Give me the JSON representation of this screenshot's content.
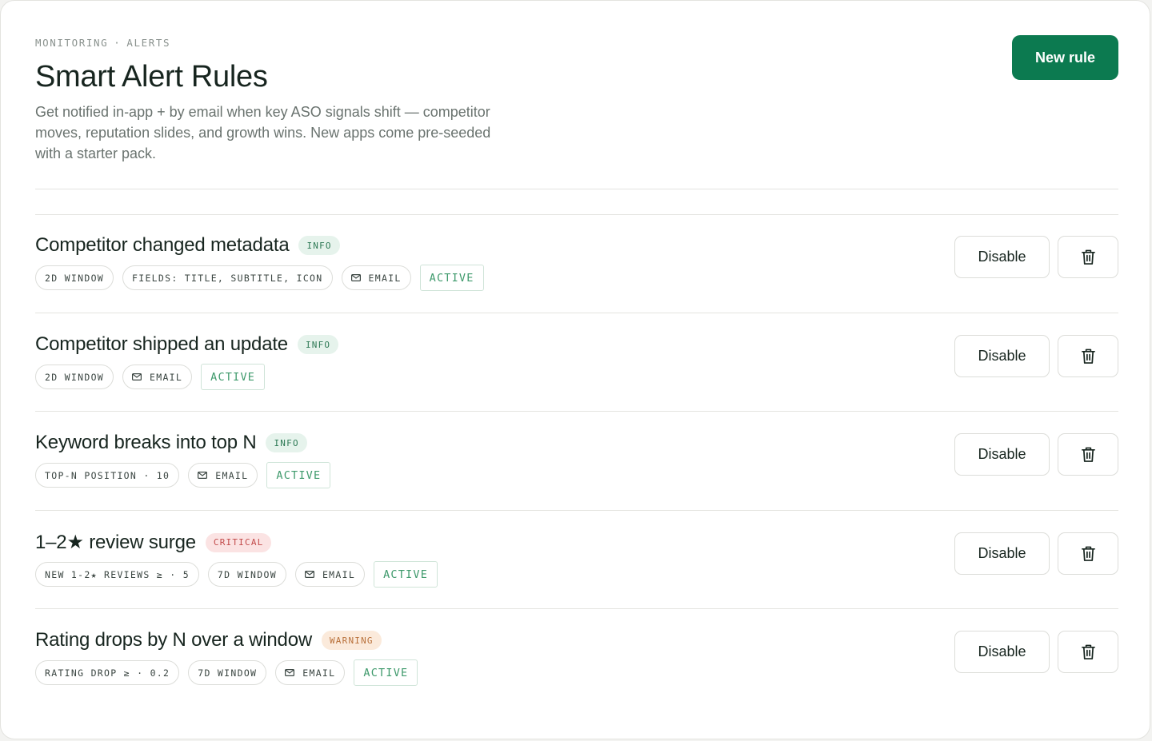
{
  "header": {
    "breadcrumb": [
      "MONITORING",
      "ALERTS"
    ],
    "breadcrumb_separator": "·",
    "title": "Smart Alert Rules",
    "subtitle": "Get notified in-app + by email when key ASO signals shift — competitor moves, reputation slides, and growth wins. New apps come pre-seeded with a starter pack.",
    "new_rule_label": "New rule"
  },
  "colors": {
    "accent": "#0c7a50",
    "info": "#2f7a56",
    "critical": "#c24a4a",
    "warning": "#b8703a",
    "active": "#3f9a6c"
  },
  "rules": [
    {
      "title": "Competitor changed metadata",
      "severity": "INFO",
      "severity_level": "info",
      "chips": [
        "2D WINDOW",
        "FIELDS: TITLE, SUBTITLE, ICON"
      ],
      "channel": "EMAIL",
      "channel_icon": "mail-icon",
      "status": "ACTIVE",
      "disable_label": "Disable",
      "delete_icon": "trash-icon"
    },
    {
      "title": "Competitor shipped an update",
      "severity": "INFO",
      "severity_level": "info",
      "chips": [
        "2D WINDOW"
      ],
      "channel": "EMAIL",
      "channel_icon": "mail-icon",
      "status": "ACTIVE",
      "disable_label": "Disable",
      "delete_icon": "trash-icon"
    },
    {
      "title": "Keyword breaks into top N",
      "severity": "INFO",
      "severity_level": "info",
      "chips": [
        "TOP-N POSITION · 10"
      ],
      "channel": "EMAIL",
      "channel_icon": "mail-icon",
      "status": "ACTIVE",
      "disable_label": "Disable",
      "delete_icon": "trash-icon"
    },
    {
      "title": "1–2★ review surge",
      "severity": "CRITICAL",
      "severity_level": "critical",
      "chips": [
        "NEW 1-2★ REVIEWS ≥ · 5",
        "7D WINDOW"
      ],
      "channel": "EMAIL",
      "channel_icon": "mail-icon",
      "status": "ACTIVE",
      "disable_label": "Disable",
      "delete_icon": "trash-icon"
    },
    {
      "title": "Rating drops by N over a window",
      "severity": "WARNING",
      "severity_level": "warning",
      "chips": [
        "RATING DROP ≥ · 0.2",
        "7D WINDOW"
      ],
      "channel": "EMAIL",
      "channel_icon": "mail-icon",
      "status": "ACTIVE",
      "disable_label": "Disable",
      "delete_icon": "trash-icon"
    }
  ]
}
